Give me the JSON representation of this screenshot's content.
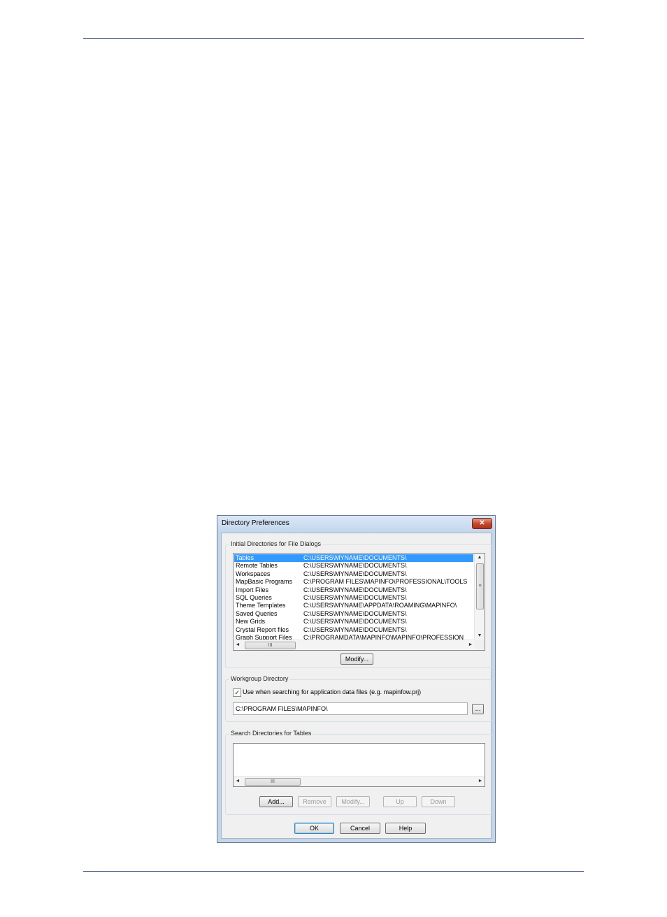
{
  "dialog": {
    "title": "Directory Preferences",
    "close_label": "✕"
  },
  "initial_dirs": {
    "group_label": "Initial Directories for File Dialogs",
    "rows": [
      {
        "name": "Tables",
        "path": "C:\\USERS\\MYNAME\\DOCUMENTS\\"
      },
      {
        "name": "Remote Tables",
        "path": "C:\\USERS\\MYNAME\\DOCUMENTS\\"
      },
      {
        "name": "Workspaces",
        "path": "C:\\USERS\\MYNAME\\DOCUMENTS\\"
      },
      {
        "name": "MapBasic Programs",
        "path": "C:\\PROGRAM FILES\\MAPINFO\\PROFESSIONAL\\TOOLS"
      },
      {
        "name": "Import Files",
        "path": "C:\\USERS\\MYNAME\\DOCUMENTS\\"
      },
      {
        "name": "SQL Queries",
        "path": "C:\\USERS\\MYNAME\\DOCUMENTS\\"
      },
      {
        "name": "Theme Templates",
        "path": "C:\\USERS\\MYNAME\\APPDATA\\ROAMING\\MAPINFO\\"
      },
      {
        "name": "Saved Queries",
        "path": "C:\\USERS\\MYNAME\\DOCUMENTS\\"
      },
      {
        "name": "New Grids",
        "path": "C:\\USERS\\MYNAME\\DOCUMENTS\\"
      },
      {
        "name": "Crystal Report files",
        "path": "C:\\USERS\\MYNAME\\DOCUMENTS\\"
      },
      {
        "name": "Graph Support Files",
        "path": "C:\\PROGRAMDATA\\MAPINFO\\MAPINFO\\PROFESSION"
      }
    ],
    "selected_index": 0,
    "modify_label": "Modify..."
  },
  "workgroup": {
    "group_label": "Workgroup Directory",
    "checkbox_label": "Use when searching for application data files (e.g. mapinfow.prj)",
    "checkbox_checked": true,
    "path_value": "C:\\PROGRAM FILES\\MAPINFO\\",
    "browse_label": "..."
  },
  "search_dirs": {
    "group_label": "Search Directories for Tables",
    "add_label": "Add...",
    "remove_label": "Remove",
    "modify_label": "Modify...",
    "up_label": "Up",
    "down_label": "Down"
  },
  "footer": {
    "ok_label": "OK",
    "cancel_label": "Cancel",
    "help_label": "Help"
  },
  "scrollbar": {
    "up_arrow": "▲",
    "down_arrow": "▼",
    "left_arrow": "◄",
    "right_arrow": "►",
    "grip": "III"
  },
  "colors": {
    "selection": "#3399ff",
    "page_rule": "#1f2a6b",
    "dialog_frame": "#c4d6ec",
    "close_button": "#c2442a"
  }
}
